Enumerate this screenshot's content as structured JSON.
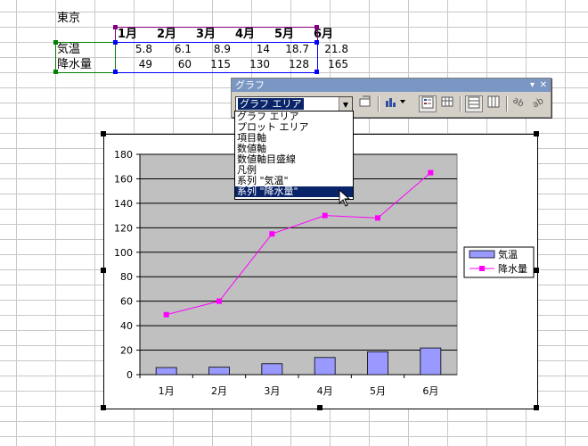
{
  "sheet": {
    "title": "東京",
    "months": [
      "1月",
      "2月",
      "3月",
      "4月",
      "5月",
      "6月"
    ],
    "rows": [
      {
        "label": "気温",
        "values": [
          "5.8",
          "6.1",
          "8.9",
          "14",
          "18.7",
          "21.8"
        ]
      },
      {
        "label": "降水量",
        "values": [
          "49",
          "60",
          "115",
          "130",
          "128",
          "165"
        ]
      }
    ]
  },
  "toolbar": {
    "title": "グラフ",
    "combo_value": "グラフ エリア",
    "close_glyph": "✕",
    "menu_glyph": "▾"
  },
  "dropdown": {
    "items": [
      "グラフ エリア",
      "プロット エリア",
      "項目軸",
      "数値軸",
      "数値軸目盛線",
      "凡例",
      "系列 \"気温\"",
      "系列 \"降水量\""
    ],
    "selected_index": 7
  },
  "chart_data": {
    "type": "bar",
    "categories": [
      "1月",
      "2月",
      "3月",
      "4月",
      "5月",
      "6月"
    ],
    "series": [
      {
        "name": "気温",
        "type": "bar",
        "values": [
          5.8,
          6.1,
          8.9,
          14,
          18.7,
          21.8
        ],
        "color": "#9999ff"
      },
      {
        "name": "降水量",
        "type": "line",
        "values": [
          49,
          60,
          115,
          130,
          128,
          165
        ],
        "color": "#ff00ff"
      }
    ],
    "ylim": [
      0,
      180
    ],
    "yticks": [
      0,
      20,
      40,
      60,
      80,
      100,
      120,
      140,
      160,
      180
    ],
    "grid": true,
    "plot_background": "#c0c0c0",
    "legend": "right"
  }
}
